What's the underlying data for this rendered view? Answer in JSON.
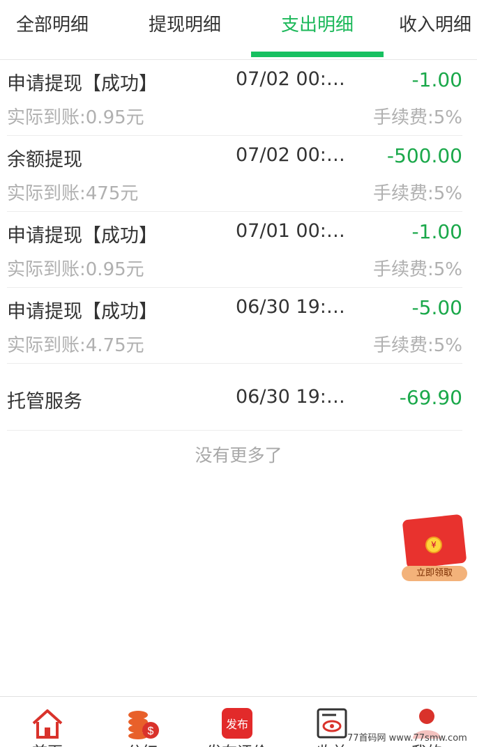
{
  "tabs": [
    {
      "label": "全部明细"
    },
    {
      "label": "提现明细"
    },
    {
      "label": "支出明细"
    },
    {
      "label": "收入明细"
    }
  ],
  "active_tab": "支出明细",
  "records": [
    {
      "title": "申请提现【成功】",
      "time": "07/02 00:…",
      "amount": "-1.00",
      "actual": "实际到账:0.95元",
      "fee": "手续费:5%"
    },
    {
      "title": "余额提现",
      "time": "07/02 00:…",
      "amount": "-500.00",
      "actual": "实际到账:475元",
      "fee": "手续费:5%"
    },
    {
      "title": "申请提现【成功】",
      "time": "07/01 00:…",
      "amount": "-1.00",
      "actual": "实际到账:0.95元",
      "fee": "手续费:5%"
    },
    {
      "title": "申请提现【成功】",
      "time": "06/30 19:…",
      "amount": "-5.00",
      "actual": "实际到账:4.75元",
      "fee": "手续费:5%"
    },
    {
      "title": "托管服务",
      "time": "06/30 19:…",
      "amount": "-69.90"
    }
  ],
  "no_more": "没有更多了",
  "red_packet": {
    "button": "立即领取",
    "coin": "¥"
  },
  "bottom_nav": [
    {
      "label": "首页",
      "icon": "home-icon"
    },
    {
      "label": "分红",
      "icon": "coins-icon"
    },
    {
      "label": "发布评价",
      "icon": "publish-icon",
      "badge": "发布"
    },
    {
      "label": "收益",
      "icon": "eye-document-icon"
    },
    {
      "label": "我的",
      "icon": "user-icon"
    }
  ],
  "watermark": "77首码网 www.77smw.com",
  "colors": {
    "accent": "#17c060",
    "amount": "#1aa84a",
    "muted": "#b0b0b0",
    "nav_red": "#d9322b"
  }
}
